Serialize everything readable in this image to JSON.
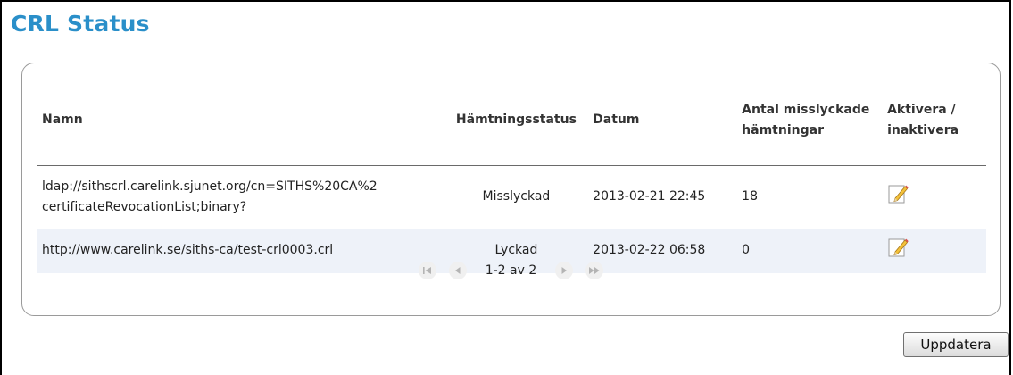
{
  "page": {
    "title": "CRL Status"
  },
  "table": {
    "headers": {
      "name": "Namn",
      "status": "Hämtningsstatus",
      "date": "Datum",
      "failed_count": "Antal misslyckade hämtningar",
      "toggle": "Aktivera / inaktivera"
    },
    "rows": [
      {
        "name": "ldap://sithscrl.carelink.sjunet.org/cn=SITHS%20CA%2 certificateRevocationList;binary?",
        "status": "Misslyckad",
        "date": "2013-02-21 22:45",
        "failed_count": "18",
        "toggle_icon": "edit-icon"
      },
      {
        "name": "http://www.carelink.se/siths-ca/test-crl0003.crl",
        "status": "Lyckad",
        "date": "2013-02-22 06:58",
        "failed_count": "0",
        "toggle_icon": "edit-icon"
      }
    ]
  },
  "pager": {
    "info": "1-2 av 2",
    "icons": [
      "first-page-icon",
      "prev-page-icon",
      "next-page-icon",
      "last-page-icon"
    ]
  },
  "actions": {
    "update_label": "Uppdatera"
  },
  "colors": {
    "title": "#2a8fc9",
    "alt_row": "#eef2f9",
    "panel_border": "#9a9a9a"
  }
}
